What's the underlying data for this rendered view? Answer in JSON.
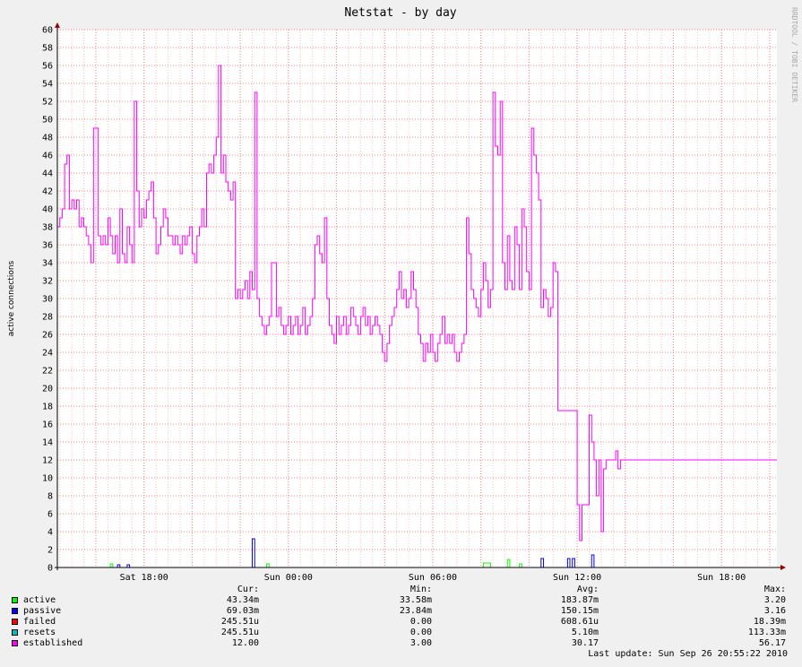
{
  "title": "Netstat - by day",
  "side_label": "RRDTOOL / TOBI OETIKER",
  "chart_data": {
    "type": "line",
    "title": "Netstat - by day",
    "ylabel": "active connections",
    "ylim": [
      0,
      60
    ],
    "yticks": [
      0,
      2,
      4,
      6,
      8,
      10,
      12,
      14,
      16,
      18,
      20,
      22,
      24,
      26,
      28,
      30,
      32,
      34,
      36,
      38,
      40,
      42,
      44,
      46,
      48,
      50,
      52,
      54,
      56,
      58,
      60
    ],
    "xlim_hours": [
      -3.6,
      26.3
    ],
    "xticks": [
      {
        "label": "Sat 18:00",
        "h": 0
      },
      {
        "label": "Sun 00:00",
        "h": 6
      },
      {
        "label": "Sun 06:00",
        "h": 12
      },
      {
        "label": "Sun 12:00",
        "h": 18
      },
      {
        "label": "Sun 18:00",
        "h": 24
      }
    ],
    "grid": true,
    "series": [
      {
        "name": "established",
        "color": "#ff00ff",
        "points": [
          [
            -3.6,
            38
          ],
          [
            -3.5,
            39
          ],
          [
            -3.4,
            40
          ],
          [
            -3.3,
            45
          ],
          [
            -3.2,
            46
          ],
          [
            -3.1,
            40
          ],
          [
            -3,
            41
          ],
          [
            -2.9,
            40
          ],
          [
            -2.8,
            41
          ],
          [
            -2.7,
            38
          ],
          [
            -2.6,
            39
          ],
          [
            -2.5,
            38
          ],
          [
            -2.4,
            37
          ],
          [
            -2.3,
            36
          ],
          [
            -2.2,
            34
          ],
          [
            -2.1,
            49
          ],
          [
            -2,
            49
          ],
          [
            -1.9,
            37
          ],
          [
            -1.8,
            36
          ],
          [
            -1.7,
            37
          ],
          [
            -1.6,
            36
          ],
          [
            -1.5,
            39
          ],
          [
            -1.4,
            37
          ],
          [
            -1.3,
            35
          ],
          [
            -1.2,
            37
          ],
          [
            -1.1,
            34
          ],
          [
            -1,
            40
          ],
          [
            -0.9,
            35
          ],
          [
            -0.8,
            34
          ],
          [
            -0.7,
            38
          ],
          [
            -0.6,
            36
          ],
          [
            -0.5,
            34
          ],
          [
            -0.4,
            52
          ],
          [
            -0.3,
            42
          ],
          [
            -0.2,
            38
          ],
          [
            -0.1,
            40
          ],
          [
            0,
            39
          ],
          [
            0.1,
            41
          ],
          [
            0.2,
            42
          ],
          [
            0.3,
            43
          ],
          [
            0.4,
            39
          ],
          [
            0.5,
            35
          ],
          [
            0.6,
            36
          ],
          [
            0.7,
            38
          ],
          [
            0.8,
            40
          ],
          [
            0.9,
            39
          ],
          [
            1,
            37
          ],
          [
            1.1,
            37
          ],
          [
            1.2,
            36
          ],
          [
            1.3,
            37
          ],
          [
            1.4,
            36
          ],
          [
            1.5,
            35
          ],
          [
            1.6,
            37
          ],
          [
            1.7,
            36
          ],
          [
            1.8,
            37
          ],
          [
            1.9,
            38
          ],
          [
            2,
            35
          ],
          [
            2.1,
            34
          ],
          [
            2.2,
            37
          ],
          [
            2.3,
            38
          ],
          [
            2.4,
            40
          ],
          [
            2.5,
            38
          ],
          [
            2.6,
            44
          ],
          [
            2.7,
            45
          ],
          [
            2.8,
            44
          ],
          [
            2.9,
            46
          ],
          [
            3,
            48
          ],
          [
            3.1,
            56
          ],
          [
            3.2,
            44
          ],
          [
            3.3,
            46
          ],
          [
            3.4,
            43
          ],
          [
            3.5,
            42
          ],
          [
            3.6,
            41
          ],
          [
            3.7,
            43
          ],
          [
            3.8,
            30
          ],
          [
            3.9,
            31
          ],
          [
            4,
            30
          ],
          [
            4.1,
            31
          ],
          [
            4.2,
            32
          ],
          [
            4.3,
            30
          ],
          [
            4.4,
            33
          ],
          [
            4.5,
            31
          ],
          [
            4.6,
            53
          ],
          [
            4.7,
            30
          ],
          [
            4.8,
            28
          ],
          [
            4.9,
            27
          ],
          [
            5,
            26
          ],
          [
            5.1,
            27
          ],
          [
            5.2,
            28
          ],
          [
            5.3,
            34
          ],
          [
            5.4,
            34
          ],
          [
            5.5,
            28
          ],
          [
            5.6,
            29
          ],
          [
            5.7,
            27
          ],
          [
            5.8,
            26
          ],
          [
            5.9,
            27
          ],
          [
            6,
            28
          ],
          [
            6.1,
            26
          ],
          [
            6.2,
            27
          ],
          [
            6.3,
            28
          ],
          [
            6.4,
            26
          ],
          [
            6.5,
            27
          ],
          [
            6.6,
            29
          ],
          [
            6.7,
            26
          ],
          [
            6.8,
            27
          ],
          [
            6.9,
            28
          ],
          [
            7,
            30
          ],
          [
            7.1,
            36
          ],
          [
            7.2,
            37
          ],
          [
            7.3,
            35
          ],
          [
            7.4,
            34
          ],
          [
            7.5,
            39
          ],
          [
            7.6,
            30
          ],
          [
            7.7,
            27
          ],
          [
            7.8,
            26
          ],
          [
            7.9,
            25
          ],
          [
            8,
            28
          ],
          [
            8.1,
            26
          ],
          [
            8.2,
            27
          ],
          [
            8.3,
            28
          ],
          [
            8.4,
            26
          ],
          [
            8.5,
            27
          ],
          [
            8.6,
            29
          ],
          [
            8.7,
            28
          ],
          [
            8.8,
            27
          ],
          [
            8.9,
            26
          ],
          [
            9,
            28
          ],
          [
            9.1,
            29
          ],
          [
            9.2,
            27
          ],
          [
            9.3,
            28
          ],
          [
            9.4,
            26
          ],
          [
            9.5,
            27
          ],
          [
            9.6,
            28
          ],
          [
            9.7,
            27
          ],
          [
            9.8,
            26
          ],
          [
            9.9,
            24
          ],
          [
            10,
            23
          ],
          [
            10.1,
            25
          ],
          [
            10.2,
            27
          ],
          [
            10.3,
            28
          ],
          [
            10.4,
            29
          ],
          [
            10.5,
            31
          ],
          [
            10.6,
            33
          ],
          [
            10.7,
            30
          ],
          [
            10.8,
            31
          ],
          [
            10.9,
            29
          ],
          [
            11,
            30
          ],
          [
            11.1,
            33
          ],
          [
            11.2,
            31
          ],
          [
            11.3,
            29
          ],
          [
            11.4,
            26
          ],
          [
            11.5,
            25
          ],
          [
            11.6,
            23
          ],
          [
            11.7,
            25
          ],
          [
            11.8,
            24
          ],
          [
            11.9,
            26
          ],
          [
            12,
            24
          ],
          [
            12.1,
            23
          ],
          [
            12.2,
            25
          ],
          [
            12.3,
            26
          ],
          [
            12.4,
            28
          ],
          [
            12.5,
            25
          ],
          [
            12.6,
            26
          ],
          [
            12.7,
            25
          ],
          [
            12.8,
            26
          ],
          [
            12.9,
            24
          ],
          [
            13,
            23
          ],
          [
            13.1,
            24
          ],
          [
            13.2,
            25
          ],
          [
            13.3,
            26
          ],
          [
            13.4,
            39
          ],
          [
            13.5,
            35
          ],
          [
            13.6,
            31
          ],
          [
            13.7,
            30
          ],
          [
            13.8,
            29
          ],
          [
            13.9,
            28
          ],
          [
            14,
            31
          ],
          [
            14.1,
            34
          ],
          [
            14.2,
            32
          ],
          [
            14.3,
            29
          ],
          [
            14.4,
            31
          ],
          [
            14.5,
            53
          ],
          [
            14.6,
            47
          ],
          [
            14.7,
            46
          ],
          [
            14.8,
            52
          ],
          [
            14.9,
            34
          ],
          [
            15,
            31
          ],
          [
            15.1,
            37
          ],
          [
            15.2,
            32
          ],
          [
            15.3,
            31
          ],
          [
            15.4,
            38
          ],
          [
            15.5,
            36
          ],
          [
            15.6,
            31
          ],
          [
            15.7,
            40
          ],
          [
            15.8,
            38
          ],
          [
            15.9,
            33
          ],
          [
            16,
            31
          ],
          [
            16.1,
            49
          ],
          [
            16.2,
            46
          ],
          [
            16.3,
            44
          ],
          [
            16.4,
            41
          ],
          [
            16.5,
            29
          ],
          [
            16.6,
            31
          ],
          [
            16.7,
            30
          ],
          [
            16.8,
            28
          ],
          [
            16.9,
            29
          ],
          [
            17,
            34
          ],
          [
            17.1,
            33
          ],
          [
            17.2,
            17.5
          ],
          [
            17.3,
            17.5
          ],
          [
            17.4,
            17.5
          ],
          [
            17.5,
            17.5
          ],
          [
            17.6,
            17.5
          ],
          [
            17.7,
            17.5
          ],
          [
            17.8,
            17.5
          ],
          [
            18,
            7
          ],
          [
            18.1,
            3
          ],
          [
            18.2,
            7
          ],
          [
            18.3,
            7
          ],
          [
            18.4,
            7
          ],
          [
            18.5,
            17
          ],
          [
            18.6,
            14
          ],
          [
            18.7,
            12
          ],
          [
            18.8,
            8
          ],
          [
            18.9,
            12
          ],
          [
            19,
            4
          ],
          [
            19.1,
            11
          ],
          [
            19.2,
            12
          ],
          [
            19.3,
            12
          ],
          [
            19.4,
            12
          ],
          [
            19.5,
            12
          ],
          [
            19.6,
            13
          ],
          [
            19.7,
            11
          ],
          [
            19.8,
            12
          ],
          [
            19.9,
            12
          ],
          [
            20,
            12
          ]
        ]
      },
      {
        "name": "active",
        "color": "#00ff00",
        "points": [
          [
            -3.6,
            0
          ],
          [
            -1.5,
            0
          ],
          [
            -1.4,
            0.4
          ],
          [
            -1.3,
            0
          ],
          [
            5,
            0
          ],
          [
            5.1,
            0.4
          ],
          [
            5.2,
            0
          ],
          [
            14,
            0
          ],
          [
            14.1,
            0.5
          ],
          [
            14.3,
            0.5
          ],
          [
            14.4,
            0
          ],
          [
            15,
            0
          ],
          [
            15.1,
            0.9
          ],
          [
            15.2,
            0
          ],
          [
            15.5,
            0
          ],
          [
            15.6,
            0.4
          ],
          [
            15.7,
            0
          ],
          [
            26.3,
            0
          ]
        ]
      },
      {
        "name": "passive",
        "color": "#0000ff",
        "points": [
          [
            -3.6,
            0
          ],
          [
            -1.2,
            0
          ],
          [
            -1.1,
            0.3
          ],
          [
            -1,
            0
          ],
          [
            -0.8,
            0
          ],
          [
            -0.7,
            0.3
          ],
          [
            -0.6,
            0
          ],
          [
            4.4,
            0
          ],
          [
            4.5,
            3.2
          ],
          [
            4.6,
            0
          ],
          [
            16.4,
            0
          ],
          [
            16.5,
            1
          ],
          [
            16.6,
            0
          ],
          [
            17.5,
            0
          ],
          [
            17.6,
            1
          ],
          [
            17.7,
            0
          ],
          [
            17.8,
            1
          ],
          [
            17.9,
            0
          ],
          [
            18.5,
            0
          ],
          [
            18.6,
            1.4
          ],
          [
            18.7,
            0
          ],
          [
            26.3,
            0
          ]
        ]
      }
    ]
  },
  "legend": {
    "headers": {
      "cur": "Cur:",
      "min": "Min:",
      "avg": "Avg:",
      "max": "Max:"
    },
    "rows": [
      {
        "name": "active",
        "color": "#00ff00",
        "cur": "43.34m",
        "min": "33.58m",
        "avg": "183.87m",
        "max": "3.20"
      },
      {
        "name": "passive",
        "color": "#0000ff",
        "cur": "69.03m",
        "min": "23.84m",
        "avg": "150.15m",
        "max": "3.16"
      },
      {
        "name": "failed",
        "color": "#ff0000",
        "cur": "245.51u",
        "min": "0.00",
        "avg": "608.61u",
        "max": "18.39m"
      },
      {
        "name": "resets",
        "color": "#00c0c0",
        "cur": "245.51u",
        "min": "0.00",
        "avg": "5.10m",
        "max": "113.33m"
      },
      {
        "name": "established",
        "color": "#ff00ff",
        "cur": "12.00",
        "min": "3.00",
        "avg": "30.17",
        "max": "56.17"
      }
    ],
    "last_update": "Last update: Sun Sep 26 20:55:22 2010"
  }
}
